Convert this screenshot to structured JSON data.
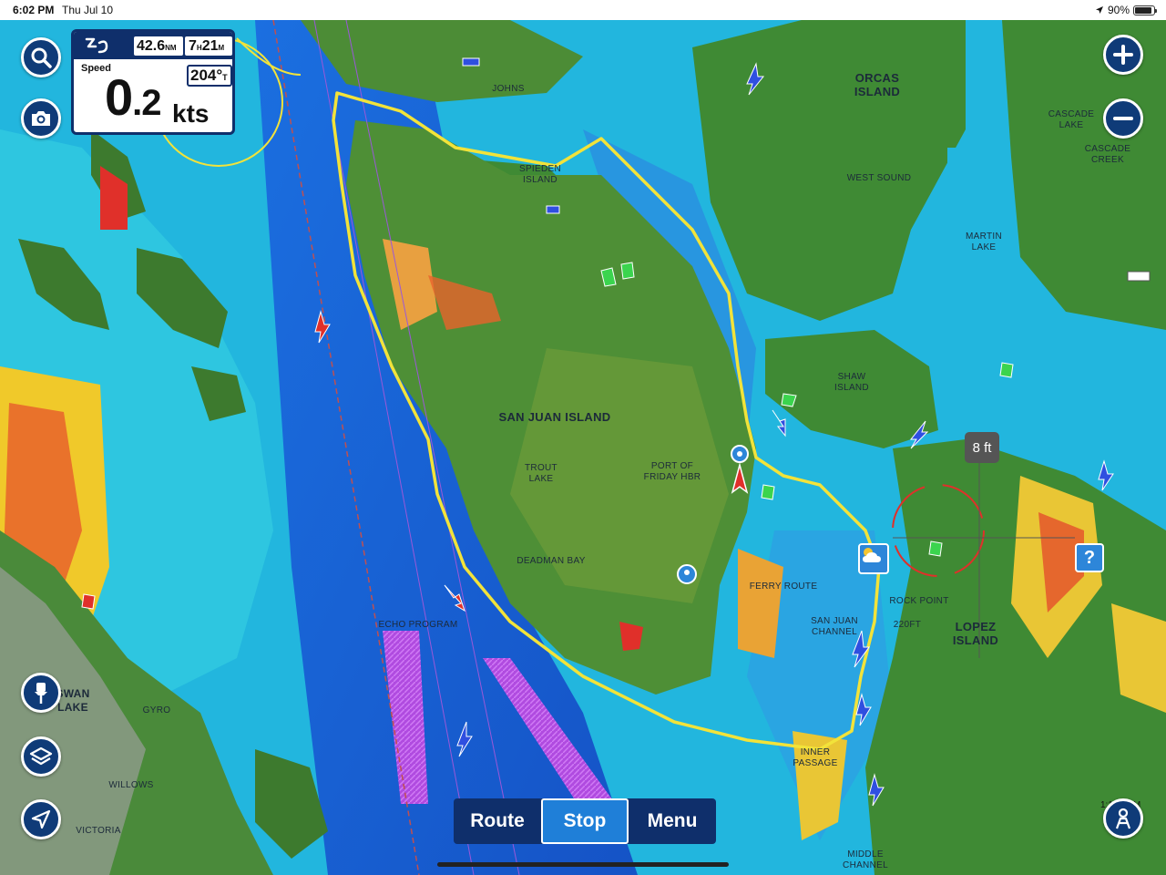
{
  "status": {
    "time": "6:02 PM",
    "date": "Thu Jul 10",
    "battery": "90%",
    "battery_level": 0.9
  },
  "panel": {
    "distance_value": "42.6",
    "distance_unit": "NM",
    "duration_hours": "7",
    "duration_h_unit": "H",
    "duration_minutes": "21",
    "duration_m_unit": "M",
    "speed_label": "Speed",
    "speed_int": "0",
    "speed_dec": ".2",
    "speed_unit": "kts",
    "heading_value": "204°",
    "heading_unit": "T"
  },
  "toolbar": {
    "route_label": "Route",
    "stop_label": "Stop",
    "menu_label": "Menu"
  },
  "map": {
    "depth_tag": "8 ft",
    "unknown_marker": "?",
    "scale_value": "1:1",
    "scale_unit": "NM",
    "labels": {
      "orcas": "ORCAS ISLAND",
      "san_juan": "SAN JUAN ISLAND",
      "lopez": "LOPEZ ISLAND",
      "shaw": "SHAW ISLAND",
      "west_sound": "WEST SOUND",
      "martin_lake": "MARTIN LAKE",
      "cascade_lake": "CASCADE LAKE",
      "cascade_creek": "CASCADE CREEK",
      "port_friday": "PORT OF FRIDAY HBR",
      "trout_lake": "TROUT LAKE",
      "deadman_bay": "DEADMAN BAY",
      "ferry_route": "FERRY ROUTE",
      "san_juan_channel": "SAN JUAN CHANNEL",
      "rock_point": "ROCK POINT",
      "depth_220": "220FT",
      "echo_program": "ECHO PROGRAM",
      "spieden": "SPIEDEN ISLAND",
      "johns": "JOHNS",
      "swan_lake": "SWAN LAKE",
      "willows": "WILLOWS",
      "victoria": "VICTORIA",
      "gyro": "GYRO",
      "cattle_pass": "INNER PASSAGE",
      "middle_channel": "MIDDLE CHANNEL"
    }
  },
  "icons": {
    "search": "search-icon",
    "camera": "camera-icon",
    "zoom_in": "plus-icon",
    "zoom_out": "minus-icon",
    "pin": "pin-icon",
    "layers": "layers-icon",
    "locate": "location-arrow-icon",
    "profile": "person-icon"
  },
  "colors": {
    "panel_dark": "#0f2f6b",
    "active_button": "#1f7fd8",
    "track": "#f2e33a",
    "deep_water": "#1a63d6",
    "shallow_water": "#2ec6e0",
    "land": "#3f8a34"
  }
}
